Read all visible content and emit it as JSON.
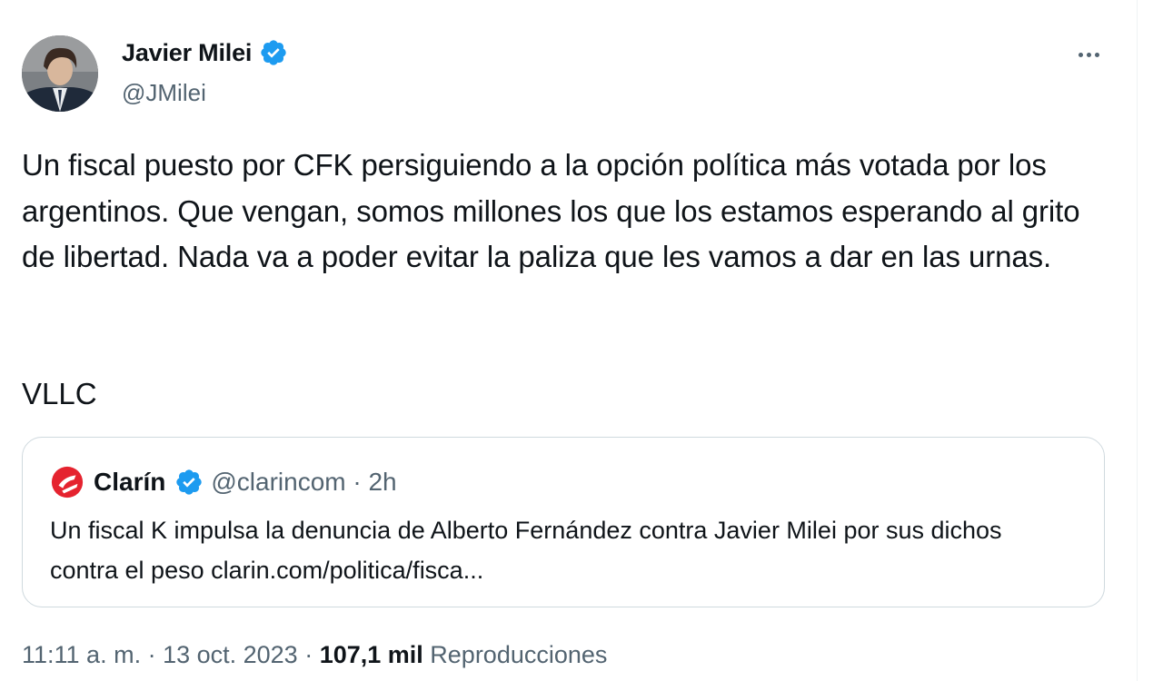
{
  "author": {
    "name": "Javier Milei",
    "handle": "@JMilei",
    "verified_color": "#1d9bf0"
  },
  "tweet": {
    "text": "Un fiscal puesto por CFK persiguiendo a la opción política más votada por los argentinos. Que vengan, somos millones los que los estamos esperando al grito de libertad. Nada va a poder evitar la paliza que les vamos a dar en las urnas.",
    "sign_off": "VLLC",
    "time": "11:11 a. m.",
    "sep1": " · ",
    "date": "13 oct. 2023",
    "sep2": " · ",
    "views": "107,1 mil",
    "views_label": " Reproducciones"
  },
  "quote": {
    "name": "Clarín",
    "handle": "@clarincom",
    "separator": " · ",
    "time": "2h",
    "text": "Un fiscal K impulsa la denuncia de Alberto Fernández contra Javier Milei por sus dichos contra el peso clarin.com/politica/fisca...",
    "logo_color": "#e5232f"
  },
  "icons": {
    "more": "more-horizontal-icon",
    "verified": "verified-badge-icon",
    "clarin_logo": "clarin-logo-icon"
  }
}
